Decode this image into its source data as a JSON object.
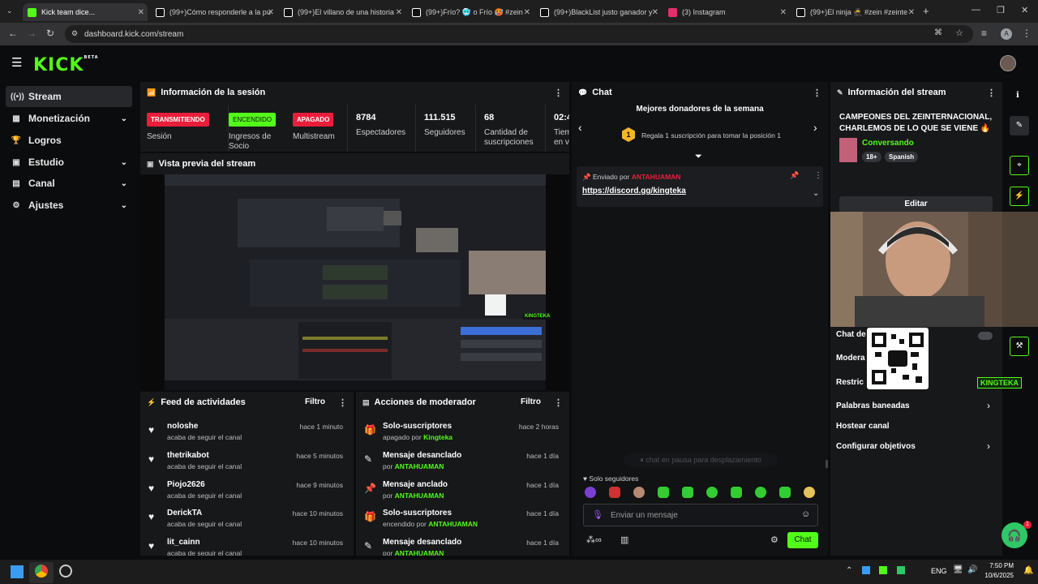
{
  "browser": {
    "tabs": [
      {
        "title": "Kick team dice...",
        "active": true,
        "favicon_color": "#53fc18"
      },
      {
        "title": "(99+)Cómo responderle a la pu",
        "active": false,
        "favicon_color": "#ffffff"
      },
      {
        "title": "(99+)El villano de una historia",
        "active": false,
        "favicon_color": "#ffffff"
      },
      {
        "title": "(99+)Frío? 🥶 o Frío 🥵 #zein",
        "active": false,
        "favicon_color": "#ffffff"
      },
      {
        "title": "(99+)BlackList justo ganador y",
        "active": false,
        "favicon_color": "#ffffff"
      },
      {
        "title": "(3) Instagram",
        "active": false,
        "favicon_color": "#e1306c"
      },
      {
        "title": "(99+)El ninja 🥷 #zein #zeinte",
        "active": false,
        "favicon_color": "#ffffff"
      }
    ],
    "url": "dashboard.kick.com/stream",
    "avatar_letter": "A"
  },
  "kick": {
    "logo": "KICK",
    "logo_tag": "BETA",
    "accent": "#53fc18"
  },
  "sidebar": {
    "items": [
      {
        "label": "Stream",
        "icon": "broadcast-icon",
        "glyph": "((•))",
        "active": true,
        "chevron": false
      },
      {
        "label": "Monetización",
        "icon": "dollar-icon",
        "glyph": "▦",
        "active": false,
        "chevron": true
      },
      {
        "label": "Logros",
        "icon": "trophy-icon",
        "glyph": "🏆",
        "active": false,
        "chevron": false
      },
      {
        "label": "Estudio",
        "icon": "studio-icon",
        "glyph": "▣",
        "active": false,
        "chevron": true
      },
      {
        "label": "Canal",
        "icon": "channel-icon",
        "glyph": "▤",
        "active": false,
        "chevron": true
      },
      {
        "label": "Ajustes",
        "icon": "gear-icon",
        "glyph": "⚙",
        "active": false,
        "chevron": true
      }
    ]
  },
  "session": {
    "title": "Información de la sesión",
    "stats": [
      {
        "pill": "TRANSMITIENDO",
        "pill_color": "#e91e3a",
        "label": "Sesión"
      },
      {
        "pill": "ENCENDIDO",
        "pill_color": "#53fc18",
        "label": "Ingresos de Socio"
      },
      {
        "pill": "APAGADO",
        "pill_color": "#e91e3a",
        "label": "Multistream"
      },
      {
        "value": "8784",
        "label": "Espectadores"
      },
      {
        "value": "111.515",
        "label": "Seguidores"
      },
      {
        "value": "68",
        "label": "Cantidad de suscripciones"
      },
      {
        "value": "02:4",
        "label": "Tiem en vi"
      }
    ]
  },
  "preview": {
    "title": "Vista previa del stream",
    "logo_text": "KINGTEKA"
  },
  "feed": {
    "title": "Feed de actividades",
    "filter": "Filtro",
    "items": [
      {
        "name": "noloshe",
        "sub": "acaba de seguir el canal",
        "time": "hace 1 minuto"
      },
      {
        "name": "thetrikabot",
        "sub": "acaba de seguir el canal",
        "time": "hace 5 minutos"
      },
      {
        "name": "Piojo2626",
        "sub": "acaba de seguir el canal",
        "time": "hace 9 minutos"
      },
      {
        "name": "DerickTA",
        "sub": "acaba de seguir el canal",
        "time": "hace 10 minutos"
      },
      {
        "name": "lit_cainn",
        "sub": "acaba de seguir el canal",
        "time": "hace 10 minutos"
      }
    ]
  },
  "modactions": {
    "title": "Acciones de moderador",
    "filter": "Filtro",
    "items": [
      {
        "name": "Solo-suscriptores",
        "sub": "apagado por",
        "who": "Kingteka",
        "time": "hace 2 horas",
        "glyph": "🎁"
      },
      {
        "name": "Mensaje desanclado",
        "sub": "por",
        "who": "ANTAHUAMAN",
        "time": "hace 1 día",
        "glyph": "✎"
      },
      {
        "name": "Mensaje anclado",
        "sub": "por",
        "who": "ANTAHUAMAN",
        "time": "hace 1 día",
        "glyph": "📌"
      },
      {
        "name": "Solo-suscriptores",
        "sub": "encendido por",
        "who": "ANTAHUAMAN",
        "time": "hace 1 día",
        "glyph": "🎁"
      },
      {
        "name": "Mensaje desanclado",
        "sub": "por",
        "who": "ANTAHUAMAN",
        "time": "hace 1 día",
        "glyph": "✎"
      }
    ]
  },
  "chat": {
    "title": "Chat",
    "donors_title": "Mejores donadores de la semana",
    "donor_rank": "1",
    "donor_text": "Regala 1 suscripción para tomar la posición 1",
    "pinned_label": "Enviado por",
    "pinned_user": "ANTAHUAMAN",
    "pinned_link": "https://discord.gg/kingteka",
    "paused": "chat en pausa para desplazamiento",
    "followers_only": "Solo seguidores",
    "input_placeholder": "Enviar un mensaje",
    "send_label": "Chat"
  },
  "streaminfo": {
    "title": "Información del stream",
    "stream_title": "CAMPEONES DEL ZEINTERNACIONAL, CHARLEMOS DE LO QUE SE VIENE 🔥",
    "category": "Conversando",
    "tags": [
      "18+",
      "Spanish"
    ],
    "edit_label": "Editar",
    "settings": [
      {
        "label": "Chat de",
        "chev": false
      },
      {
        "label": "Modera",
        "chev": false
      },
      {
        "label": "Restric",
        "chev": false
      },
      {
        "label": "Palabras baneadas",
        "chev": true
      },
      {
        "label": "Hostear canal",
        "chev": false
      },
      {
        "label": "Configurar objetivos",
        "chev": true
      }
    ],
    "overlay_text": "KINGTEKA"
  },
  "taskbar": {
    "lang": "ENG",
    "time": "7:50 PM",
    "date": "10/6/2025"
  },
  "colors": {
    "accent": "#53fc18",
    "live": "#e91e3a",
    "panel": "#17181a"
  }
}
